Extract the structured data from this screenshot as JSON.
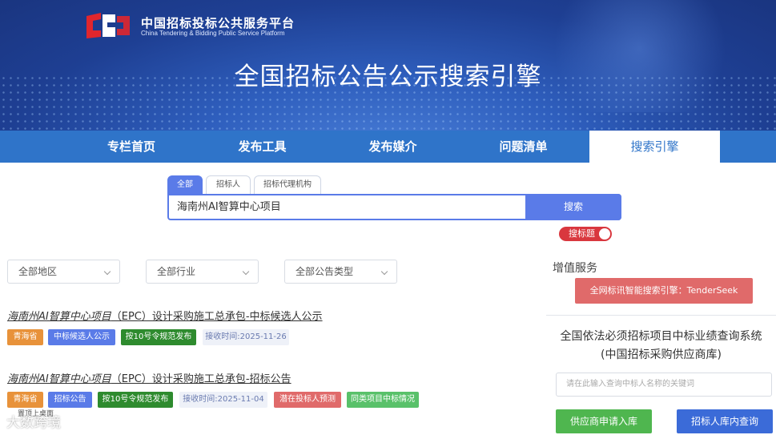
{
  "header": {
    "brand_cn": "中国招标投标公共服务平台",
    "brand_en": "China Tendering & Bidding Public Service Platform",
    "headline": "全国招标公告公示搜索引擎"
  },
  "nav": {
    "items": [
      {
        "label": "专栏首页"
      },
      {
        "label": "发布工具"
      },
      {
        "label": "发布媒介"
      },
      {
        "label": "问题清单"
      },
      {
        "label": "搜索引擎",
        "active": true
      }
    ]
  },
  "search": {
    "tabs": [
      {
        "label": "全部",
        "active": true
      },
      {
        "label": "招标人"
      },
      {
        "label": "招标代理机构"
      }
    ],
    "query": "海南州AI智算中心项目",
    "button": "搜索",
    "toggle_label": "搜标题"
  },
  "filters": {
    "region": "全部地区",
    "industry": "全部行业",
    "notice_type": "全部公告类型"
  },
  "results": [
    {
      "title_highlight": "海南州AI智算中心项目",
      "title_rest": "（EPC）设计采购施工总承包-中标候选人公示",
      "tags": [
        "青海省",
        "中标候选人公示",
        "按10号令规范发布",
        "接收时间:2025-11-26"
      ]
    },
    {
      "title_highlight": "海南州AI智算中心项目",
      "title_rest": "（EPC）设计采购施工总承包-招标公告",
      "tags": [
        "青海省",
        "招标公告",
        "按10号令规范发布",
        "接收时间:2025-11-04",
        "潜在投标人预测",
        "同类项目中标情况"
      ]
    }
  ],
  "sidebar": {
    "value_added_heading": "增值服务",
    "smart_search_button": "全网标讯智能搜索引擎：TenderSeek",
    "query_title_line1": "全国依法必须招标项目中标业绩查询系统",
    "query_title_line2": "(中国招标采购供应商库)",
    "query_placeholder": "请在此输入查询中标人名称的关键词",
    "supplier_button": "供应商申请入库",
    "tenderer_button": "招标人库内查询"
  },
  "watermark": {
    "text": "大数跨境",
    "sub": "置顶上桌面"
  },
  "colors": {
    "nav_blue": "#2f74c9",
    "search_blue": "#5a7be8",
    "toggle_red": "#d9373e",
    "tag_orange": "#e8923a",
    "tag_green": "#2e8b2e",
    "button_red": "#e06a6a",
    "button_green": "#4fb64f"
  }
}
